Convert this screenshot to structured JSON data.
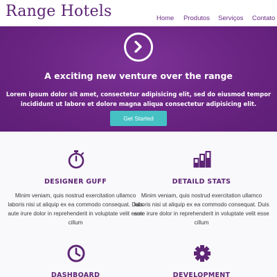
{
  "brand": {
    "name": "Range Hotels"
  },
  "nav": {
    "items": [
      {
        "label": "Home"
      },
      {
        "label": "Produtos"
      },
      {
        "label": "Serviços"
      },
      {
        "label": "Contato"
      }
    ]
  },
  "hero": {
    "icon": "chevron-right-circle-icon",
    "title": "A exciting new venture over the range",
    "text": "Lorem ipsum dolor sit amet, consectetur adipisicing elit, sed do eiusmod tempor incididunt ut labore et dolore magna aliqua consectetur adipisicing elit.",
    "button_label": "Get Started"
  },
  "features": [
    {
      "icon": "stopwatch-icon",
      "title": "DESIGNER GUFF",
      "text": "Minim veniam, quis nostrud exercitation ullamco laboris nisi ut aliquip ex ea commodo consequat. Duis aute irure dolor in reprehenderit in voluptate velit esse cillum"
    },
    {
      "icon": "bar-chart-icon",
      "title": "DETAILD STATS",
      "text": "Minim veniam, quis nostrud exercitation ullamco laboris nisi ut aliquip ex ea commodo consequat. Duis aute irure dolor in reprehenderit in voluptate velit esse cillum"
    },
    {
      "icon": "clock-icon",
      "title": "DASHBOARD"
    },
    {
      "icon": "gear-icon",
      "title": "DEVELOPMENT"
    }
  ],
  "colors": {
    "brand": "#5a2373",
    "hero_bg": "#6a2482",
    "button": "#45c1c4",
    "feature_title": "#5d2574",
    "features_bg": "#f9f8fb"
  }
}
